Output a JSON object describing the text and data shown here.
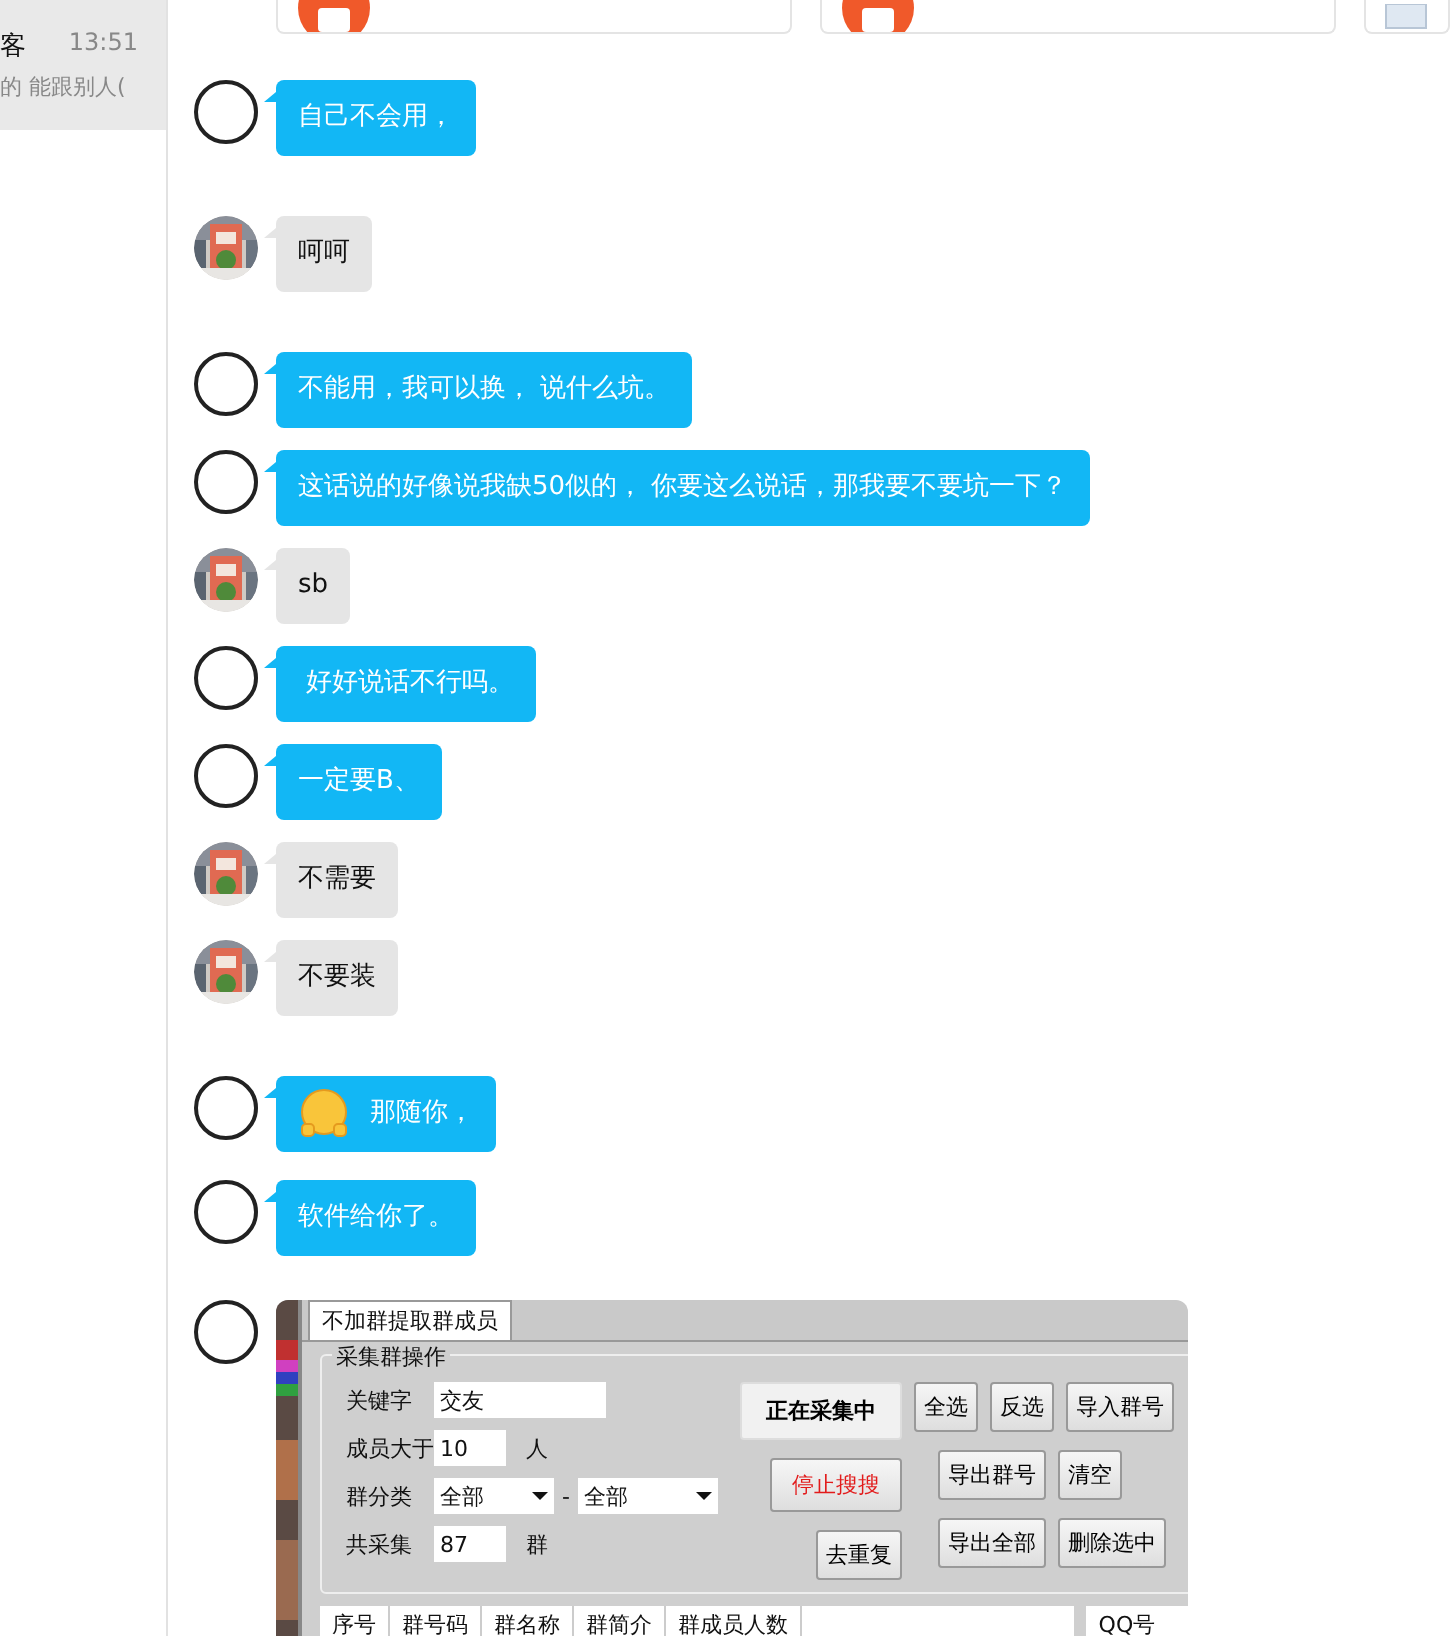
{
  "sidebar": {
    "items": [
      {
        "name": "客",
        "time": "13:51",
        "preview": "的 能跟别人(",
        "selected": true
      }
    ]
  },
  "top_cards": [
    {
      "kind": "bag"
    },
    {
      "kind": "bag"
    },
    {
      "kind": "doc"
    }
  ],
  "messages": [
    {
      "outgoing": true,
      "kind": "text",
      "text": "自己不会用，"
    },
    {
      "outgoing": false,
      "kind": "text",
      "text": "呵呵"
    },
    {
      "outgoing": true,
      "kind": "text",
      "text": "不能用，我可以换， 说什么坑。"
    },
    {
      "outgoing": true,
      "kind": "text",
      "text": "这话说的好像说我缺50似的， 你要这么说话，那我要不要坑一下？"
    },
    {
      "outgoing": false,
      "kind": "text",
      "text": "sb"
    },
    {
      "outgoing": true,
      "kind": "text",
      "text": " 好好说话不行吗。"
    },
    {
      "outgoing": true,
      "kind": "text",
      "text": "一定要B、"
    },
    {
      "outgoing": false,
      "kind": "text",
      "text": "不需要"
    },
    {
      "outgoing": false,
      "kind": "text",
      "text": "不要装"
    },
    {
      "outgoing": true,
      "kind": "emoji_text",
      "text": "那随你，"
    },
    {
      "outgoing": true,
      "kind": "text",
      "text": "软件给你了。"
    },
    {
      "outgoing": true,
      "kind": "screenshot"
    }
  ],
  "shared_window": {
    "tab": "不加群提取群成员",
    "group_title": "采集群操作",
    "fields": [
      {
        "kind": "text",
        "label": "关键字",
        "value": "交友"
      },
      {
        "kind": "text",
        "label": "成员大于",
        "value": "10",
        "unit": "人"
      },
      {
        "kind": "select_pair",
        "label": "群分类",
        "value": "全部",
        "separator": "-",
        "value2": "全部"
      },
      {
        "kind": "text",
        "label": "共采集",
        "value": "87",
        "unit": "群"
      }
    ],
    "middle_buttons": [
      {
        "label": "正在采集中",
        "kind": "primary"
      },
      {
        "label": "停止搜搜",
        "kind": "danger"
      },
      {
        "label": "去重复",
        "kind": "normal"
      }
    ],
    "right_button_rows": [
      [
        "全选",
        "反选",
        "导入群号"
      ],
      [
        "导出群号",
        "清空"
      ],
      [
        "导出全部",
        "删除选中"
      ]
    ],
    "columns": [
      "序号",
      "群号码",
      "群名称",
      "群简介",
      "群成员人数"
    ],
    "side_column": "QQ号"
  }
}
